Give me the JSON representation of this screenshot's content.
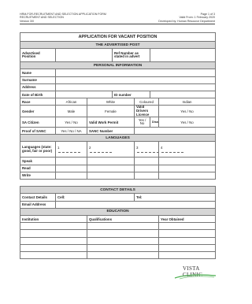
{
  "header": {
    "left_line1": "HRM-FOR-RECRUITMENT AND SELECTION APPLICATION FORM",
    "right_line1": "Page 1 of 3",
    "left_line2": "RECRUITMENT AND SELECTION",
    "right_line2": "Valid From: 1 February 2020",
    "left_line3": "Version 3/0",
    "right_line3": "Developed by: Human Resource Department"
  },
  "form": {
    "title": "APPLICATION FOR VACANT POSITION",
    "advertised_section": "THE ADVERTISED POST",
    "advertised_position": "Advertised Position",
    "ref_number": "Ref Number as stated in advert",
    "personal_section": "PERSONAL INFORMATION",
    "name": "Name",
    "surname": "Surname",
    "address": "Address",
    "dob": "Date of Birth",
    "id_number": "ID number",
    "race": "Race",
    "race_options": [
      "African",
      "White",
      "Coloured",
      "Indian"
    ],
    "gender": "Gender",
    "male": "Male",
    "female": "Female",
    "valid_drivers": "Valid Drivers Licence",
    "yes_no": "Yes / No",
    "sa_citizen": "SA Citizen",
    "valid_work_permit": "Valid Work Permit",
    "yes_no_stacked": "Yes / No",
    "disability": "Disability",
    "proof_of_sanc": "Proof of SANC",
    "yes_no_na": "Yes / No / NA",
    "sanc_number": "SANC Number",
    "languages_section": "LANGUAGES",
    "languages_label": "Languages (state: good, fair or poor)",
    "lang_numbers": [
      "1",
      "2",
      "3",
      "4"
    ],
    "speak": "Speak",
    "read": "Read",
    "write": "Write",
    "contact_section": "CONTACT DETAILS",
    "contact_details": "Contact Details",
    "cell": "Cell:",
    "tel": "Tel:",
    "email": "Email Address",
    "education_section": "EDUCATION",
    "institution": "Institution",
    "qualifications": "Qualifications",
    "year_obtained": "Year Obtained"
  },
  "logo": {
    "text": "VISTA CLINIC",
    "accent_color": "#4caf50"
  }
}
